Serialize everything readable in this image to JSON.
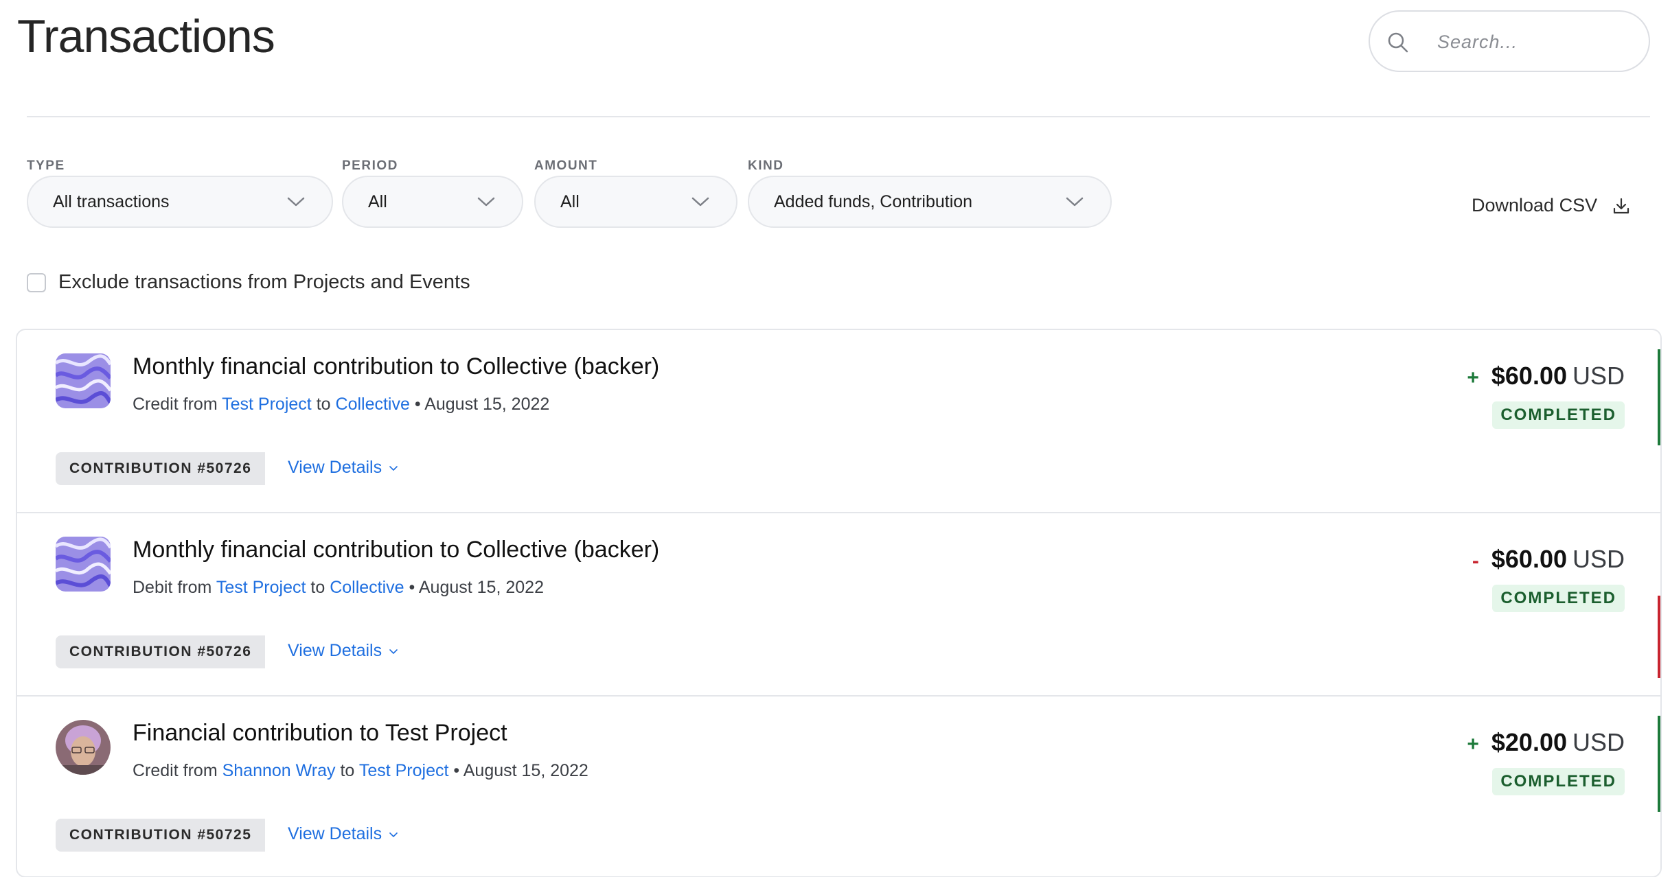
{
  "page": {
    "title": "Transactions"
  },
  "search": {
    "placeholder": "Search..."
  },
  "filters": {
    "type": {
      "label": "TYPE",
      "value": "All transactions"
    },
    "period": {
      "label": "PERIOD",
      "value": "All"
    },
    "amount": {
      "label": "AMOUNT",
      "value": "All"
    },
    "kind": {
      "label": "KIND",
      "value": "Added funds, Contribution"
    }
  },
  "download_label": "Download CSV",
  "exclude_label": "Exclude transactions from Projects and Events",
  "colors": {
    "link": "#1f6fe0",
    "credit": "#1d7a3a",
    "debit": "#c8242f",
    "status_bg": "#e5f6ea",
    "status_text": "#1b5e2e"
  },
  "transactions": [
    {
      "title": "Monthly financial contribution to Collective (backer)",
      "direction": "Credit",
      "from_word": "from",
      "from": "Test Project",
      "to_word": "to",
      "to": "Collective",
      "separator": "•",
      "date": "August 15, 2022",
      "sign": "+",
      "amount": "$60.00",
      "currency": "USD",
      "status": "COMPLETED",
      "tag": "CONTRIBUTION #50726",
      "details_label": "View Details",
      "avatar": "pattern-avatar"
    },
    {
      "title": "Monthly financial contribution to Collective (backer)",
      "direction": "Debit",
      "from_word": "from",
      "from": "Test Project",
      "to_word": "to",
      "to": "Collective",
      "separator": "•",
      "date": "August 15, 2022",
      "sign": "-",
      "amount": "$60.00",
      "currency": "USD",
      "status": "COMPLETED",
      "tag": "CONTRIBUTION #50726",
      "details_label": "View Details",
      "avatar": "pattern-avatar"
    },
    {
      "title": "Financial contribution to Test Project",
      "direction": "Credit",
      "from_word": "from",
      "from": "Shannon Wray",
      "to_word": "to",
      "to": "Test Project",
      "separator": "•",
      "date": "August 15, 2022",
      "sign": "+",
      "amount": "$20.00",
      "currency": "USD",
      "status": "COMPLETED",
      "tag": "CONTRIBUTION #50725",
      "details_label": "View Details",
      "avatar": "person-avatar"
    }
  ]
}
